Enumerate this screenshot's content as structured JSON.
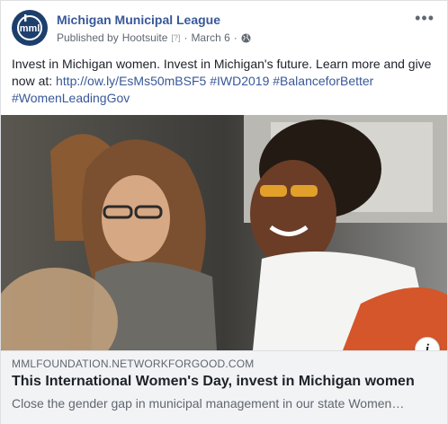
{
  "post": {
    "page_name": "Michigan Municipal League",
    "published_by_prefix": "Published by",
    "publisher": "Hootsuite",
    "publisher_marker": "[?]",
    "separator": "·",
    "date": "March 6",
    "separator2": "·",
    "text_before": "Invest in Michigan women. Invest in Michigan's future. Learn more and give now at: ",
    "link_url": "http://ow.ly/EsMs50mBSF5",
    "hashtags": [
      "#IWD2019",
      "#BalanceforBetter",
      "#WomenLeadingGov"
    ],
    "more_glyph": "•••"
  },
  "avatar": {
    "initials": "mml",
    "color": "#1d3f6c"
  },
  "link_card": {
    "domain": "MMLFOUNDATION.NETWORKFORGOOD.COM",
    "title": "This International Women's Day, invest in Michigan women",
    "description": "Close the gender gap in municipal management in our state Women…",
    "info_glyph": "i"
  },
  "colors": {
    "link": "#385898",
    "meta": "#606770",
    "card_bg": "#f2f3f5"
  },
  "icons": [
    "globe-icon",
    "more-options-icon",
    "info-icon"
  ]
}
